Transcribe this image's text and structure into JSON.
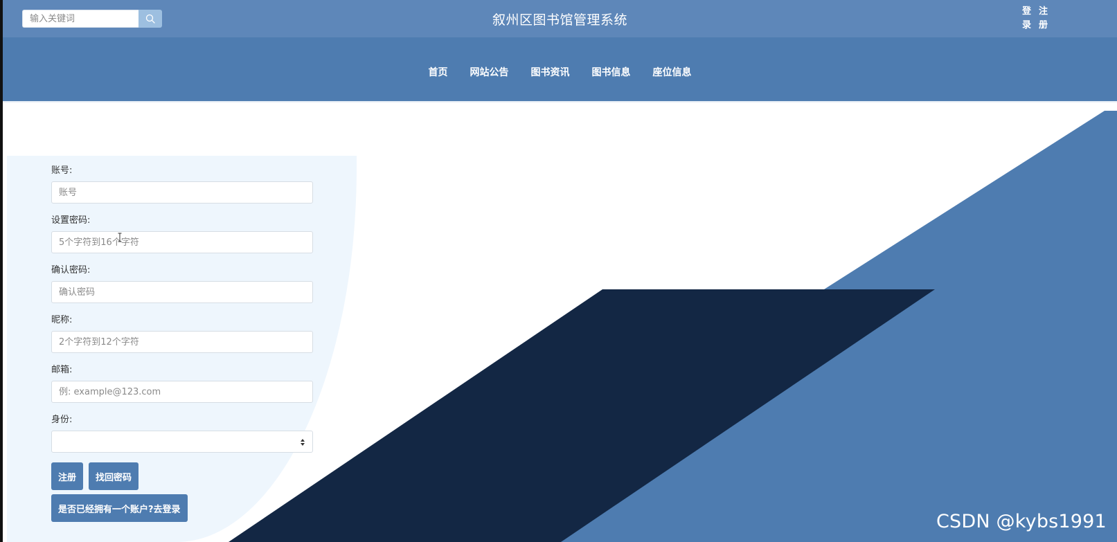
{
  "header": {
    "search_placeholder": "输入关键词",
    "title": "叙州区图书馆管理系统",
    "auth": {
      "login_top": "登",
      "login_bottom": "录",
      "register_top": "注",
      "register_bottom": "册"
    }
  },
  "nav": {
    "items": [
      {
        "label": "首页"
      },
      {
        "label": "网站公告"
      },
      {
        "label": "图书资讯"
      },
      {
        "label": "图书信息"
      },
      {
        "label": "座位信息"
      }
    ]
  },
  "form": {
    "account": {
      "label": "账号:",
      "placeholder": "账号"
    },
    "password": {
      "label": "设置密码:",
      "placeholder": "5个字符到16个字符"
    },
    "confirm": {
      "label": "确认密码:",
      "placeholder": "确认密码"
    },
    "nickname": {
      "label": "昵称:",
      "placeholder": "2个字符到12个字符"
    },
    "email": {
      "label": "邮箱:",
      "placeholder": "例: example@123.com"
    },
    "role": {
      "label": "身份:",
      "selected": ""
    },
    "buttons": {
      "register": "注册",
      "recover": "找回密码",
      "go_login": "是否已经拥有一个账户?去登录"
    }
  },
  "watermark": "CSDN @kybs1991",
  "colors": {
    "topbar": "#5e87b9",
    "navbar": "#4e7cb0",
    "button": "#4e7cb0",
    "panel": "#eef6fd",
    "dark_shape": "#132744",
    "blue_shape": "#4e7cb0"
  }
}
